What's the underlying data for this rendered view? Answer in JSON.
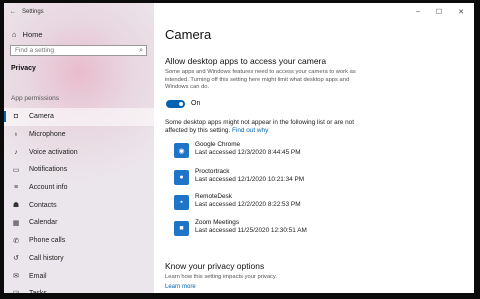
{
  "window": {
    "back_glyph": "←",
    "title": "Settings",
    "controls": {
      "minimize": "–",
      "maximize": "☐",
      "close": "✕"
    }
  },
  "sidebar": {
    "home_label": "Home",
    "search_placeholder": "Find a setting",
    "section_title": "Privacy",
    "group_label": "App permissions",
    "items": [
      {
        "label": "Camera",
        "icon": "camera-icon",
        "glyph": "◘",
        "active": true
      },
      {
        "label": "Microphone",
        "icon": "microphone-icon",
        "glyph": "♁"
      },
      {
        "label": "Voice activation",
        "icon": "voice-icon",
        "glyph": "♪"
      },
      {
        "label": "Notifications",
        "icon": "notifications-icon",
        "glyph": "▭"
      },
      {
        "label": "Account info",
        "icon": "account-icon",
        "glyph": "≡"
      },
      {
        "label": "Contacts",
        "icon": "contacts-icon",
        "glyph": "☗"
      },
      {
        "label": "Calendar",
        "icon": "calendar-icon",
        "glyph": "▦"
      },
      {
        "label": "Phone calls",
        "icon": "phone-icon",
        "glyph": "✆"
      },
      {
        "label": "Call history",
        "icon": "history-icon",
        "glyph": "↺"
      },
      {
        "label": "Email",
        "icon": "email-icon",
        "glyph": "✉"
      },
      {
        "label": "Tasks",
        "icon": "tasks-icon",
        "glyph": "☑"
      }
    ]
  },
  "main": {
    "title": "Camera",
    "heading": "Allow desktop apps to access your camera",
    "description": "Some apps and Windows features need to access your camera to work as intended. Turning off this setting here might limit what desktop apps and Windows can do.",
    "toggle_label": "On",
    "note": "Some desktop apps might not appear in the following list or are not affected by this setting.",
    "note_link": "Find out why",
    "apps": [
      {
        "name": "Google Chrome",
        "last": "Last accessed 12/3/2020 8:44:45 PM",
        "color": "#1f74c8"
      },
      {
        "name": "Proctortrack",
        "last": "Last accessed 12/1/2020 10:21:34 PM",
        "color": "#1f74c8"
      },
      {
        "name": "RemoteDesk",
        "last": "Last accessed 12/2/2020 8:22:53 PM",
        "color": "#1f74c8"
      },
      {
        "name": "Zoom Meetings",
        "last": "Last accessed 11/25/2020 12:30:51 AM",
        "color": "#1f74c8"
      }
    ],
    "privacy_heading": "Know your privacy options",
    "privacy_desc": "Learn how this setting impacts your privacy.",
    "privacy_link": "Learn more"
  },
  "colors": {
    "accent": "#0063b1"
  }
}
